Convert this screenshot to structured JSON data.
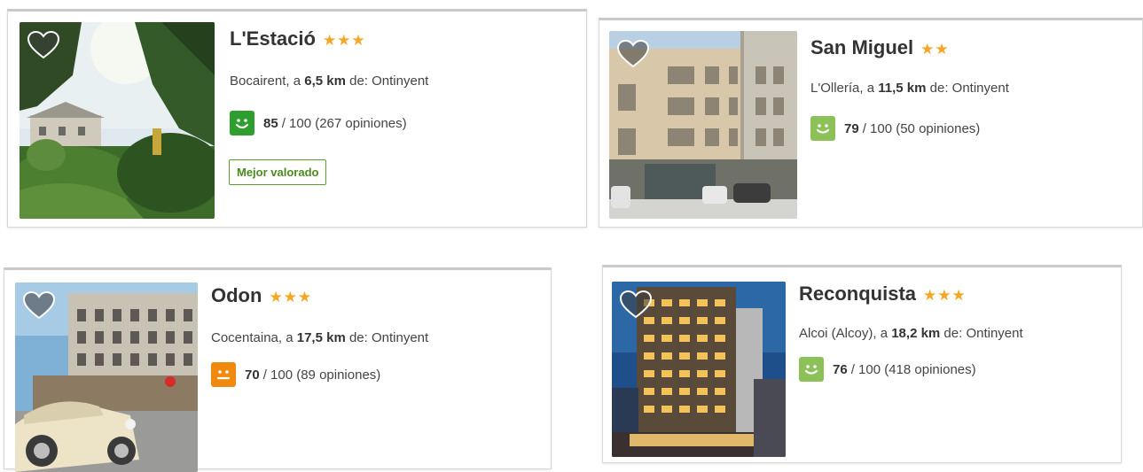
{
  "colors": {
    "star": "#f5a623",
    "rating_excellent": "#2e9e2e",
    "rating_good": "#8cc158",
    "rating_ok": "#f08a0f",
    "badge": "#4b8a1f"
  },
  "hotels": [
    {
      "name": "L'Estació",
      "stars": "★★★",
      "town": "Bocairent",
      "sep": ", a ",
      "distance": "6,5 km",
      "suffix": " de: Ontinyent",
      "score": "85",
      "score_rest": "/ 100 (267 opiniones)",
      "badge": "Mejor valorado",
      "face_icon": "smile-face-icon",
      "favorite_icon": "heart-icon"
    },
    {
      "name": "San Miguel",
      "stars": "★★",
      "town": "L'Ollería",
      "sep": ", a ",
      "distance": "11,5 km",
      "suffix": " de: Ontinyent",
      "score": "79",
      "score_rest": "/ 100 (50 opiniones)",
      "face_icon": "smile-face-icon",
      "favorite_icon": "heart-icon"
    },
    {
      "name": "Odon",
      "stars": "★★★",
      "town": "Cocentaina",
      "sep": ", a ",
      "distance": "17,5 km",
      "suffix": " de: Ontinyent",
      "score": "70",
      "score_rest": "/ 100 (89 opiniones)",
      "face_icon": "neutral-face-icon",
      "favorite_icon": "heart-icon"
    },
    {
      "name": "Reconquista",
      "stars": "★★★",
      "town": "Alcoi (Alcoy)",
      "sep": ", a ",
      "distance": "18,2 km",
      "suffix": " de: Ontinyent",
      "score": "76",
      "score_rest": "/ 100 (418 opiniones)",
      "face_icon": "smile-face-icon",
      "favorite_icon": "heart-icon"
    }
  ]
}
